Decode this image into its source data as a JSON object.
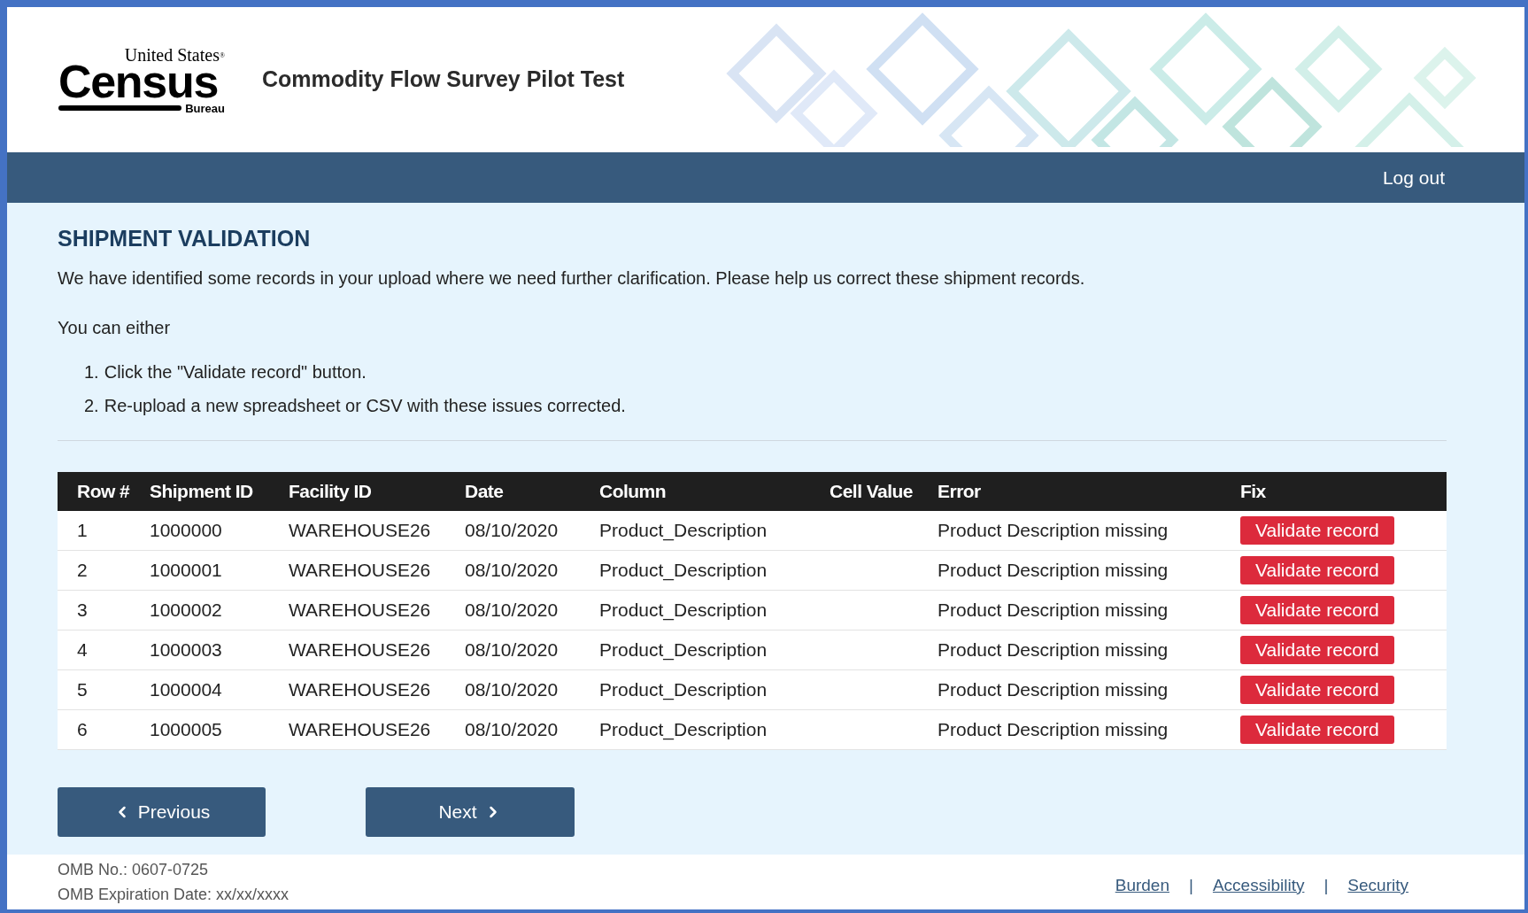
{
  "logo": {
    "top": "United States",
    "mark": "®",
    "main": "Census",
    "bottom": "Bureau"
  },
  "header": {
    "title": "Commodity Flow Survey Pilot Test"
  },
  "nav": {
    "logout": "Log out"
  },
  "page": {
    "heading": "SHIPMENT VALIDATION",
    "intro": "We have identified some records in your upload where we need further clarification. Please help us correct these shipment records.",
    "lead": "You can either",
    "steps": [
      {
        "number": "1.",
        "text": "Click the \"Validate record\" button."
      },
      {
        "number": "2.",
        "text": "Re-upload a new spreadsheet or CSV with these issues corrected."
      }
    ]
  },
  "table": {
    "columns": [
      "Row #",
      "Shipment ID",
      "Facility ID",
      "Date",
      "Column",
      "Cell Value",
      "Error",
      "Fix"
    ],
    "rows": [
      {
        "row": "1",
        "shipment_id": "1000000",
        "facility_id": "WAREHOUSE26",
        "date": "08/10/2020",
        "column": "Product_Description",
        "error": "Product Description missing",
        "fix": "Validate record"
      },
      {
        "row": "2",
        "shipment_id": "1000001",
        "facility_id": "WAREHOUSE26",
        "date": "08/10/2020",
        "column": "Product_Description",
        "error": "Product Description missing",
        "fix": "Validate record"
      },
      {
        "row": "3",
        "shipment_id": "1000002",
        "facility_id": "WAREHOUSE26",
        "date": "08/10/2020",
        "column": "Product_Description",
        "error": "Product Description missing",
        "fix": "Validate record"
      },
      {
        "row": "4",
        "shipment_id": "1000003",
        "facility_id": "WAREHOUSE26",
        "date": "08/10/2020",
        "column": "Product_Description",
        "error": "Product Description missing",
        "fix": "Validate record"
      },
      {
        "row": "5",
        "shipment_id": "1000004",
        "facility_id": "WAREHOUSE26",
        "date": "08/10/2020",
        "column": "Product_Description",
        "error": "Product Description missing",
        "fix": "Validate record"
      },
      {
        "row": "6",
        "shipment_id": "1000005",
        "facility_id": "WAREHOUSE26",
        "date": "08/10/2020",
        "column": "Product_Description",
        "error": "Product Description missing",
        "fix": "Validate record"
      }
    ]
  },
  "pager": {
    "previous": "Previous",
    "next": "Next"
  },
  "footer": {
    "omb_number": "OMB No.: 0607-0725",
    "omb_expiration": "OMB Expiration Date: xx/xx/xxxx",
    "links": [
      "Burden",
      "Accessibility",
      "Security"
    ],
    "separator": "|"
  }
}
